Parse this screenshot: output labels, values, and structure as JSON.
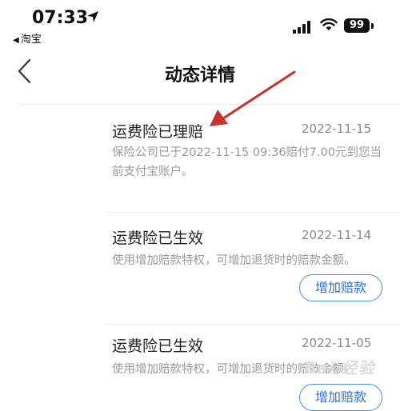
{
  "status_bar": {
    "time": "07:33",
    "back_app": "淘宝",
    "battery": "99"
  },
  "nav": {
    "title": "动态详情"
  },
  "cards": [
    {
      "title": "运费险已理赔",
      "date": "2022-11-15",
      "desc": "保险公司已于2022-11-15 09:36赔付7.00元到您当前支付宝账户。"
    },
    {
      "title": "运费险已生效",
      "date": "2022-11-14",
      "desc": "使用增加赔款特权，可增加退货时的赔款金额。",
      "button": "增加赔款"
    },
    {
      "title": "运费险已生效",
      "date": "2022-11-05",
      "desc": "使用增加赔款特权，可增加退货时的赔款金额。",
      "button": "增加赔款"
    }
  ],
  "watermark": "Bai 经验",
  "colors": {
    "accent": "#2a72d2",
    "annotation_arrow": "#c8322a",
    "muted_text": "#999999"
  }
}
